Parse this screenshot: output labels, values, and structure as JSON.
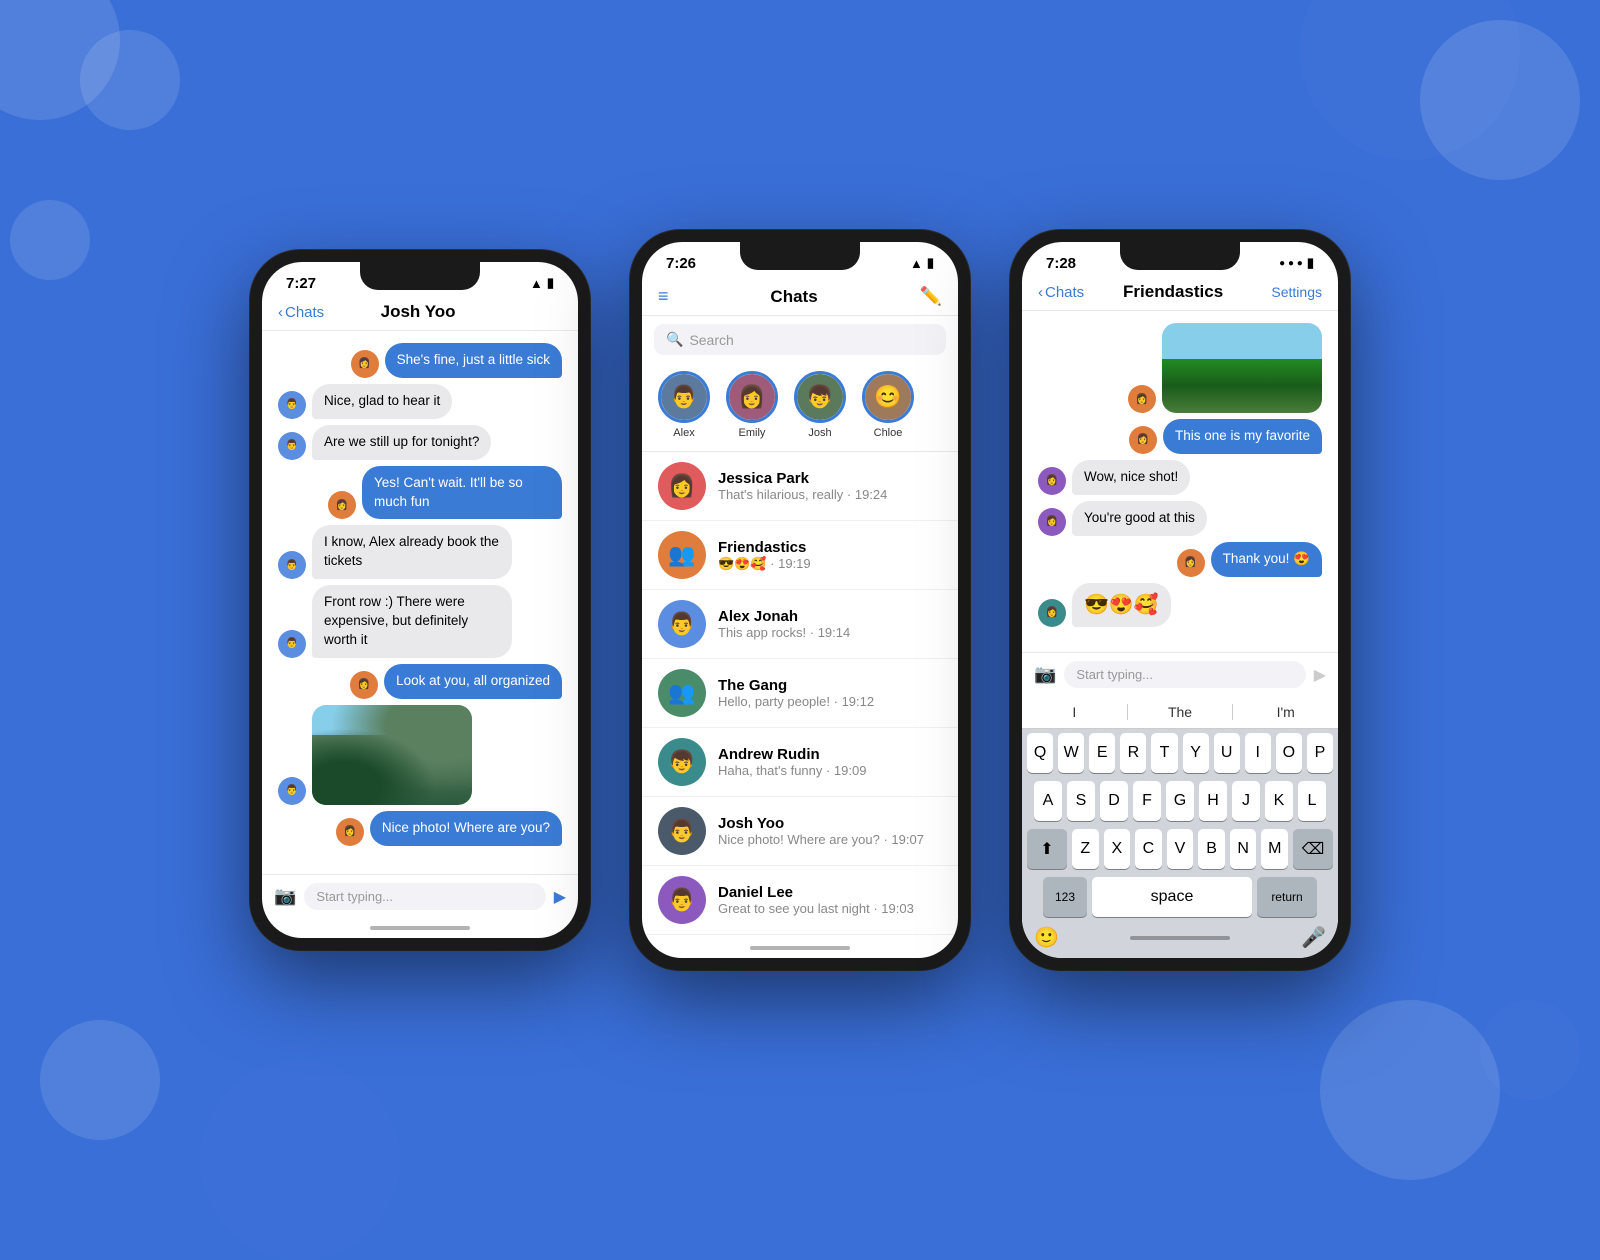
{
  "background": "#3a6fd8",
  "phone1": {
    "time": "7:27",
    "nav_back": "Chats",
    "nav_title": "Josh Yoo",
    "messages": [
      {
        "type": "sent",
        "text": "She's fine, just a little sick",
        "has_avatar": true
      },
      {
        "type": "recv",
        "text": "Nice, glad to hear it",
        "has_avatar": true
      },
      {
        "type": "recv",
        "text": "Are we still up for tonight?",
        "has_avatar": true
      },
      {
        "type": "sent",
        "text": "Yes! Can't wait. It'll be so much fun",
        "has_avatar": true
      },
      {
        "type": "recv",
        "text": "I know, Alex already book the tickets",
        "has_avatar": true
      },
      {
        "type": "recv",
        "text": "Front row :) There were expensive, but definitely worth it",
        "has_avatar": true
      },
      {
        "type": "sent",
        "text": "Look at you, all organized",
        "has_avatar": true
      },
      {
        "type": "recv_photo",
        "has_avatar": true
      },
      {
        "type": "sent",
        "text": "Nice photo! Where are you?",
        "has_avatar": true
      }
    ],
    "input_placeholder": "Start typing...",
    "recv_emoji": "👨"
  },
  "phone2": {
    "time": "7:26",
    "header_title": "Chats",
    "search_placeholder": "Search",
    "stories": [
      {
        "name": "Alex",
        "emoji": "👨"
      },
      {
        "name": "Emily",
        "emoji": "👩"
      },
      {
        "name": "Josh",
        "emoji": "👦"
      },
      {
        "name": "Chloe",
        "emoji": "😊"
      }
    ],
    "chat_list": [
      {
        "name": "Jessica Park",
        "preview": "That's hilarious, really · 19:24",
        "emoji": "👩"
      },
      {
        "name": "Friendastics",
        "preview": "😎😍🥰 · 19:19",
        "emoji": "👥"
      },
      {
        "name": "Alex Jonah",
        "preview": "This app rocks! · 19:14",
        "emoji": "👨"
      },
      {
        "name": "The Gang",
        "preview": "Hello, party people! · 19:12",
        "emoji": "👥"
      },
      {
        "name": "Andrew Rudin",
        "preview": "Haha, that's funny · 19:09",
        "emoji": "👦"
      },
      {
        "name": "Josh Yoo",
        "preview": "Nice photo! Where are you? · 19:07",
        "emoji": "👨"
      },
      {
        "name": "Daniel Lee",
        "preview": "Great to see you last night · 19:03",
        "emoji": "👨"
      }
    ]
  },
  "phone3": {
    "time": "7:28",
    "nav_back": "Chats",
    "nav_title": "Friendastics",
    "nav_right": "Settings",
    "messages": [
      {
        "type": "sent_photo"
      },
      {
        "type": "sent",
        "text": "This one is my favorite",
        "has_avatar": true
      },
      {
        "type": "recv",
        "text": "Wow, nice shot!",
        "has_avatar": true
      },
      {
        "type": "recv",
        "text": "You're good at this",
        "has_avatar": true
      },
      {
        "type": "sent",
        "text": "Thank you! 😍",
        "has_avatar": true
      },
      {
        "type": "recv_emoji",
        "text": "😎😍🥰",
        "has_avatar": true
      }
    ],
    "input_placeholder": "Start typing...",
    "keyboard": {
      "suggestions": [
        "I",
        "The",
        "I'm"
      ],
      "rows": [
        [
          "Q",
          "W",
          "E",
          "R",
          "T",
          "Y",
          "U",
          "I",
          "O",
          "P"
        ],
        [
          "A",
          "S",
          "D",
          "F",
          "G",
          "H",
          "J",
          "K",
          "L"
        ],
        [
          "Z",
          "X",
          "C",
          "V",
          "B",
          "N",
          "M"
        ],
        [
          "123",
          "space",
          "return"
        ]
      ]
    }
  },
  "labels": {
    "back_arrow": "‹",
    "camera": "📷",
    "send": "▶",
    "search_icon": "🔍",
    "compose": "✏️",
    "menu": "≡",
    "shift": "⬆",
    "delete": "⌫",
    "emoji": "🙂",
    "mic": "🎤"
  }
}
